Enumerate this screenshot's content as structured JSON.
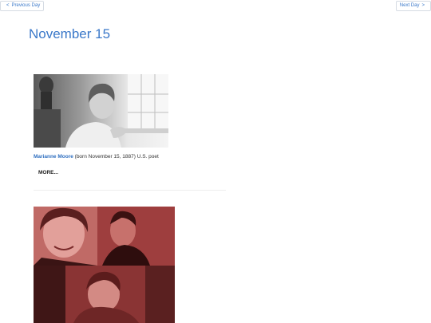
{
  "nav": {
    "prev_arrow": "<",
    "prev_label": "Previous Day",
    "next_label": "Next Day",
    "next_arrow": ">"
  },
  "page": {
    "title": "November 15"
  },
  "entries": [
    {
      "name": "Marianne Moore",
      "description": " (born November 15, 1887) U.S. poet",
      "more_label": "MORE..."
    }
  ],
  "colors": {
    "accent": "#3a78c9",
    "link": "#2f6fc0",
    "photo_tint_red": "#a84b4b"
  }
}
